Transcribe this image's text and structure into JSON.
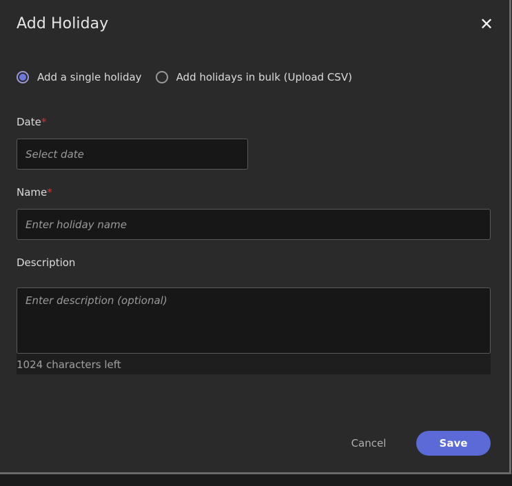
{
  "dialog": {
    "title": "Add Holiday",
    "close_icon": "close-icon"
  },
  "mode": {
    "options": [
      {
        "label": "Add a single holiday",
        "selected": true
      },
      {
        "label": "Add holidays in bulk (Upload CSV)",
        "selected": false
      }
    ]
  },
  "fields": {
    "date": {
      "label": "Date",
      "required_mark": "*",
      "placeholder": "Select date",
      "value": ""
    },
    "name": {
      "label": "Name",
      "required_mark": "*",
      "placeholder": "Enter holiday name",
      "value": ""
    },
    "description": {
      "label": "Description",
      "placeholder": "Enter description (optional)",
      "value": "",
      "chars_left": "1024 characters left"
    }
  },
  "actions": {
    "cancel_label": "Cancel",
    "save_label": "Save"
  },
  "colors": {
    "accent": "#5b6ad6",
    "required": "#e0322e",
    "background": "#2a2a2a",
    "input_background": "#171717"
  }
}
